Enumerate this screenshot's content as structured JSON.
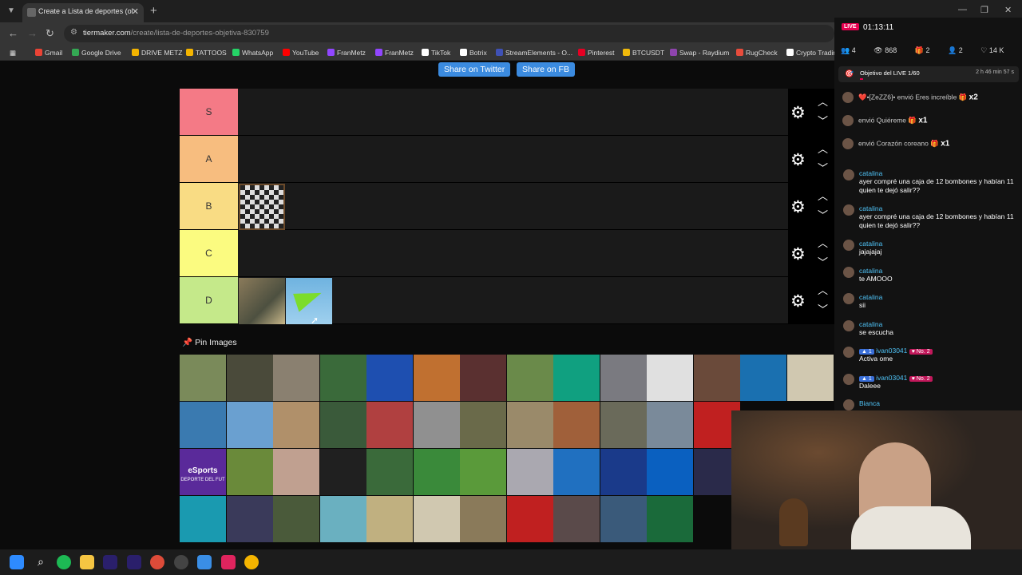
{
  "browser": {
    "tab_title": "Create a Lista de deportes (obj",
    "tab_close": "✕",
    "new_tab": "+",
    "url_host": "tiermaker.com",
    "url_path": "/create/lista-de-deportes-objetiva-830759",
    "bookmarks": [
      "Gmail",
      "Google Drive",
      "DRIVE METZ",
      "TATTOOS",
      "WhatsApp",
      "YouTube",
      "FranMetz",
      "FranMetz",
      "TikTok",
      "Botrix",
      "StreamElements - O...",
      "Pinterest",
      "BTCUSDT",
      "Swap - Raydium",
      "RugCheck",
      "Crypto Tradin"
    ],
    "bookmark_colors": [
      "#ea4335",
      "#34a853",
      "#f4b400",
      "#f4b400",
      "#25d366",
      "#ff0000",
      "#9146ff",
      "#9146ff",
      "#ffffff",
      "#ffffff",
      "#3f51b5",
      "#e60023",
      "#f0b90b",
      "#8e44ad",
      "#e74c3c",
      "#ffffff"
    ]
  },
  "page": {
    "share_twitter": "Share on Twitter",
    "share_fb": "Share on FB",
    "pin_images_label": "Pin Images",
    "esports_text": "eSports",
    "esports_sub": "DEPORTE DEL FUT",
    "tiers": [
      {
        "label": "S",
        "color": "#f47a86"
      },
      {
        "label": "A",
        "color": "#f7bd7f"
      },
      {
        "label": "B",
        "color": "#f9dc84"
      },
      {
        "label": "C",
        "color": "#fbfb80"
      },
      {
        "label": "D",
        "color": "#c5e98a"
      }
    ]
  },
  "stream": {
    "live_badge": "LIVE",
    "timer": "01:13:11",
    "stats": [
      "4",
      "868",
      "2",
      "2",
      "14 K"
    ],
    "goal_text": "Objetivo del LIVE 1/60",
    "goal_progress": 0.0167,
    "goal_time": "2 h 46 min 57 s",
    "gifts": [
      {
        "text": "❤️•[ZeZZ6]• envió Eres increíble",
        "count": "x2"
      },
      {
        "text": "envió Quiéreme",
        "count": "x1"
      },
      {
        "text": "envió Corazón coreano",
        "count": "x1"
      }
    ],
    "chat": [
      {
        "user": "catalina",
        "msg": "ayer compré una caja de 12 bombones y habían 11 quien te dejó salir??"
      },
      {
        "user": "catalina",
        "msg": "ayer compré una caja de 12 bombones y habían 11 quien te dejó salir??"
      },
      {
        "user": "catalina",
        "msg": "jajajajaj"
      },
      {
        "user": "catalina",
        "msg": "te AMOOO"
      },
      {
        "user": "catalina",
        "msg": "sii"
      },
      {
        "user": "catalina",
        "msg": "se escucha"
      },
      {
        "user": "ivan03041",
        "level": "1",
        "rank": "No. 2",
        "msg": "Activa ome"
      },
      {
        "user": "ivan03041",
        "level": "1",
        "rank": "No. 2",
        "msg": "Daleee"
      },
      {
        "user": "Bianca",
        "msg": ""
      }
    ]
  }
}
